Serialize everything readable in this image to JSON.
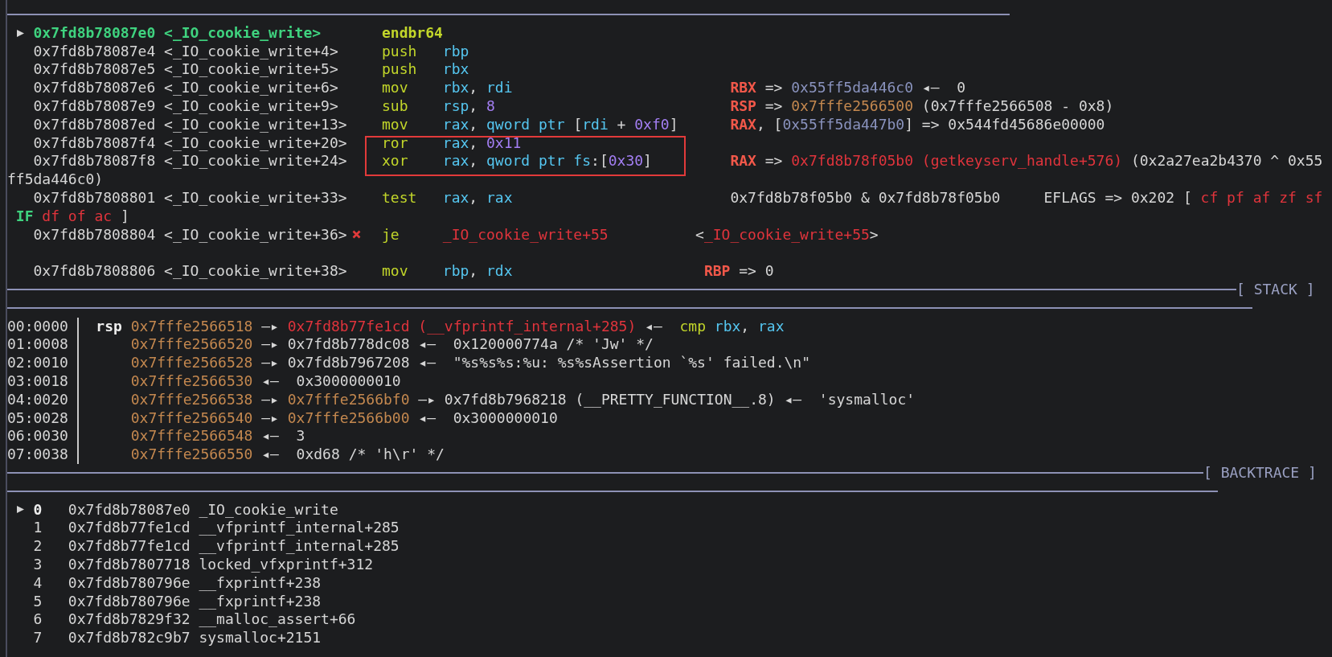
{
  "disasm": {
    "rows": [
      {
        "kind": "insn",
        "current": true,
        "highlighted": false,
        "address": "0x7fd8b78087e0",
        "symbol": "<_IO_cookie_write>",
        "mnemonic": "endbr64",
        "operands": []
      },
      {
        "kind": "insn",
        "current": false,
        "highlighted": false,
        "address": "0x7fd8b78087e4",
        "symbol": "<_IO_cookie_write+4>",
        "mnemonic": "push",
        "operands": [
          {
            "text": "rbp",
            "kind": "reg"
          }
        ]
      },
      {
        "kind": "insn",
        "current": false,
        "highlighted": false,
        "address": "0x7fd8b78087e5",
        "symbol": "<_IO_cookie_write+5>",
        "mnemonic": "push",
        "operands": [
          {
            "text": "rbx",
            "kind": "reg"
          }
        ]
      },
      {
        "kind": "insn",
        "current": false,
        "highlighted": false,
        "address": "0x7fd8b78087e6",
        "symbol": "<_IO_cookie_write+6>",
        "mnemonic": "mov",
        "operands": [
          {
            "text": "rbx",
            "kind": "reg"
          },
          {
            "text": ", ",
            "kind": "plain"
          },
          {
            "text": "rdi",
            "kind": "reg"
          }
        ],
        "annotation": [
          {
            "text": "RBX",
            "kind": "regname"
          },
          {
            "text": " => ",
            "kind": "plain"
          },
          {
            "text": "0x55ff5da446c0",
            "kind": "heap"
          },
          {
            "text": " ◂—  0",
            "kind": "plain"
          }
        ]
      },
      {
        "kind": "insn",
        "current": false,
        "highlighted": false,
        "address": "0x7fd8b78087e9",
        "symbol": "<_IO_cookie_write+9>",
        "mnemonic": "sub",
        "operands": [
          {
            "text": "rsp",
            "kind": "reg"
          },
          {
            "text": ", ",
            "kind": "plain"
          },
          {
            "text": "8",
            "kind": "num"
          }
        ],
        "annotation": [
          {
            "text": "RSP",
            "kind": "regname"
          },
          {
            "text": " => ",
            "kind": "plain"
          },
          {
            "text": "0x7fffe2566500",
            "kind": "stack"
          },
          {
            "text": " (0x7fffe2566508 - 0x8)",
            "kind": "plain"
          }
        ]
      },
      {
        "kind": "insn",
        "current": false,
        "highlighted": false,
        "address": "0x7fd8b78087ed",
        "symbol": "<_IO_cookie_write+13>",
        "mnemonic": "mov",
        "operands": [
          {
            "text": "rax",
            "kind": "reg"
          },
          {
            "text": ", ",
            "kind": "plain"
          },
          {
            "text": "qword ptr",
            "kind": "reg"
          },
          {
            "text": " [",
            "kind": "plain"
          },
          {
            "text": "rdi",
            "kind": "reg"
          },
          {
            "text": " + ",
            "kind": "plain"
          },
          {
            "text": "0xf0",
            "kind": "num"
          },
          {
            "text": "]",
            "kind": "plain"
          }
        ],
        "annotation": [
          {
            "text": "RAX",
            "kind": "regname"
          },
          {
            "text": ", [",
            "kind": "plain"
          },
          {
            "text": "0x55ff5da447b0",
            "kind": "heap"
          },
          {
            "text": "] => 0x544fd45686e00000",
            "kind": "plain"
          }
        ]
      },
      {
        "kind": "insn",
        "current": false,
        "highlighted": true,
        "address": "0x7fd8b78087f4",
        "symbol": "<_IO_cookie_write+20>",
        "mnemonic": "ror",
        "operands": [
          {
            "text": "rax",
            "kind": "reg"
          },
          {
            "text": ", ",
            "kind": "plain"
          },
          {
            "text": "0x11",
            "kind": "num"
          }
        ]
      },
      {
        "kind": "insn",
        "current": false,
        "highlighted": true,
        "address": "0x7fd8b78087f8",
        "symbol": "<_IO_cookie_write+24>",
        "mnemonic": "xor",
        "operands": [
          {
            "text": "rax",
            "kind": "reg"
          },
          {
            "text": ", ",
            "kind": "plain"
          },
          {
            "text": "qword ptr fs",
            "kind": "reg"
          },
          {
            "text": ":[",
            "kind": "plain"
          },
          {
            "text": "0x30",
            "kind": "num"
          },
          {
            "text": "]",
            "kind": "plain"
          }
        ],
        "annotation": [
          {
            "text": "RAX",
            "kind": "regname"
          },
          {
            "text": " => ",
            "kind": "plain"
          },
          {
            "text": "0x7fd8b78f05b0 (getkeyserv_handle+576)",
            "kind": "code"
          },
          {
            "text": " (0x2a27ea2b4370 ^ 0x55",
            "kind": "plain"
          }
        ]
      },
      {
        "kind": "wrap",
        "segments": [
          {
            "text": "ff5da446c0)",
            "kind": "plain"
          }
        ]
      },
      {
        "kind": "insn",
        "current": false,
        "highlighted": false,
        "address": "0x7fd8b7808801",
        "symbol": "<_IO_cookie_write+33>",
        "mnemonic": "test",
        "operands": [
          {
            "text": "rax",
            "kind": "reg"
          },
          {
            "text": ", ",
            "kind": "plain"
          },
          {
            "text": "rax",
            "kind": "reg"
          }
        ],
        "annotation": [
          {
            "text": "0x7fd8b78f05b0 & 0x7fd8b78f05b0     EFLAGS => 0x202 [",
            "kind": "plain"
          },
          {
            "text": " cf",
            "kind": "flag",
            "set": false
          },
          {
            "text": " pf",
            "kind": "flag",
            "set": false
          },
          {
            "text": " af",
            "kind": "flag",
            "set": false
          },
          {
            "text": " zf",
            "kind": "flag",
            "set": false
          },
          {
            "text": " sf",
            "kind": "flag",
            "set": false
          }
        ]
      },
      {
        "kind": "wrap",
        "segments": [
          {
            "text": " IF",
            "kind": "flag",
            "set": true
          },
          {
            "text": " df",
            "kind": "flag",
            "set": false
          },
          {
            "text": " of",
            "kind": "flag",
            "set": false
          },
          {
            "text": " ac",
            "kind": "flag",
            "set": false
          },
          {
            "text": " ]",
            "kind": "plain"
          }
        ]
      },
      {
        "kind": "insn",
        "current": false,
        "highlighted": false,
        "branch_taken": false,
        "address": "0x7fd8b7808804",
        "symbol": "<_IO_cookie_write+36>",
        "mnemonic": "je",
        "operands": [
          {
            "text": "_IO_cookie_write+55",
            "kind": "code"
          }
        ],
        "annotation": [
          {
            "text": "<",
            "kind": "plain"
          },
          {
            "text": "_IO_cookie_write+55",
            "kind": "code"
          },
          {
            "text": ">",
            "kind": "plain"
          }
        ]
      },
      {
        "kind": "blank"
      },
      {
        "kind": "insn",
        "current": false,
        "highlighted": false,
        "address": "0x7fd8b7808806",
        "symbol": "<_IO_cookie_write+38>",
        "mnemonic": "mov",
        "operands": [
          {
            "text": "rbp",
            "kind": "reg"
          },
          {
            "text": ", ",
            "kind": "plain"
          },
          {
            "text": "rdx",
            "kind": "reg"
          }
        ],
        "annotation": [
          {
            "text": "RBP",
            "kind": "regname"
          },
          {
            "text": " => 0",
            "kind": "plain"
          }
        ]
      }
    ]
  },
  "stack": {
    "title": "[ STACK ]",
    "rows": [
      {
        "offset": "00:0000",
        "register": "rsp",
        "chain": [
          {
            "text": "0x7fffe2566518",
            "kind": "stack"
          },
          {
            "text": " —▸ ",
            "kind": "arrow"
          },
          {
            "text": "0x7fd8b77fe1cd (__vfprintf_internal+285)",
            "kind": "code"
          },
          {
            "text": " ◂—  ",
            "kind": "arrow"
          },
          {
            "text": "cmp",
            "kind": "mnem"
          },
          {
            "text": " rbx",
            "kind": "reg"
          },
          {
            "text": ", ",
            "kind": "plain"
          },
          {
            "text": "rax",
            "kind": "reg"
          }
        ]
      },
      {
        "offset": "01:0008",
        "chain": [
          {
            "text": "0x7fffe2566520",
            "kind": "stack"
          },
          {
            "text": " —▸ ",
            "kind": "arrow"
          },
          {
            "text": "0x7fd8b778dc08",
            "kind": "plain"
          },
          {
            "text": " ◂—  ",
            "kind": "arrow"
          },
          {
            "text": "0x120000774a /* 'Jw' */",
            "kind": "plain"
          }
        ]
      },
      {
        "offset": "02:0010",
        "chain": [
          {
            "text": "0x7fffe2566528",
            "kind": "stack"
          },
          {
            "text": " —▸ ",
            "kind": "arrow"
          },
          {
            "text": "0x7fd8b7967208",
            "kind": "plain"
          },
          {
            "text": " ◂—  ",
            "kind": "arrow"
          },
          {
            "text": "\"%s%s%s:%u: %s%sAssertion `%s' failed.\\n\"",
            "kind": "plain"
          }
        ]
      },
      {
        "offset": "03:0018",
        "chain": [
          {
            "text": "0x7fffe2566530",
            "kind": "stack"
          },
          {
            "text": " ◂—  ",
            "kind": "arrow"
          },
          {
            "text": "0x3000000010",
            "kind": "plain"
          }
        ]
      },
      {
        "offset": "04:0020",
        "chain": [
          {
            "text": "0x7fffe2566538",
            "kind": "stack"
          },
          {
            "text": " —▸ ",
            "kind": "arrow"
          },
          {
            "text": "0x7fffe2566bf0",
            "kind": "stack"
          },
          {
            "text": " —▸ ",
            "kind": "arrow"
          },
          {
            "text": "0x7fd8b7968218 (__PRETTY_FUNCTION__.8)",
            "kind": "plain"
          },
          {
            "text": " ◂—  ",
            "kind": "arrow"
          },
          {
            "text": "'sysmalloc'",
            "kind": "plain"
          }
        ]
      },
      {
        "offset": "05:0028",
        "chain": [
          {
            "text": "0x7fffe2566540",
            "kind": "stack"
          },
          {
            "text": " —▸ ",
            "kind": "arrow"
          },
          {
            "text": "0x7fffe2566b00",
            "kind": "stack"
          },
          {
            "text": " ◂—  ",
            "kind": "arrow"
          },
          {
            "text": "0x3000000010",
            "kind": "plain"
          }
        ]
      },
      {
        "offset": "06:0030",
        "chain": [
          {
            "text": "0x7fffe2566548",
            "kind": "stack"
          },
          {
            "text": " ◂—  ",
            "kind": "arrow"
          },
          {
            "text": "3",
            "kind": "plain"
          }
        ]
      },
      {
        "offset": "07:0038",
        "chain": [
          {
            "text": "0x7fffe2566550",
            "kind": "stack"
          },
          {
            "text": " ◂—  ",
            "kind": "arrow"
          },
          {
            "text": "0xd68 /* 'h\\r' */",
            "kind": "plain"
          }
        ]
      }
    ]
  },
  "backtrace": {
    "title": "[ BACKTRACE ]",
    "frames": [
      {
        "selected": true,
        "index": "0",
        "address": "0x7fd8b78087e0",
        "symbol": "_IO_cookie_write"
      },
      {
        "selected": false,
        "index": "1",
        "address": "0x7fd8b77fe1cd",
        "symbol": "__vfprintf_internal+285"
      },
      {
        "selected": false,
        "index": "2",
        "address": "0x7fd8b77fe1cd",
        "symbol": "__vfprintf_internal+285"
      },
      {
        "selected": false,
        "index": "3",
        "address": "0x7fd8b7807718",
        "symbol": "locked_vfxprintf+312"
      },
      {
        "selected": false,
        "index": "4",
        "address": "0x7fd8b780796e",
        "symbol": "__fxprintf+238"
      },
      {
        "selected": false,
        "index": "5",
        "address": "0x7fd8b780796e",
        "symbol": "__fxprintf+238"
      },
      {
        "selected": false,
        "index": "6",
        "address": "0x7fd8b7829f32",
        "symbol": "__malloc_assert+66"
      },
      {
        "selected": false,
        "index": "7",
        "address": "0x7fd8b782c9b7",
        "symbol": "sysmalloc+2151"
      }
    ]
  }
}
